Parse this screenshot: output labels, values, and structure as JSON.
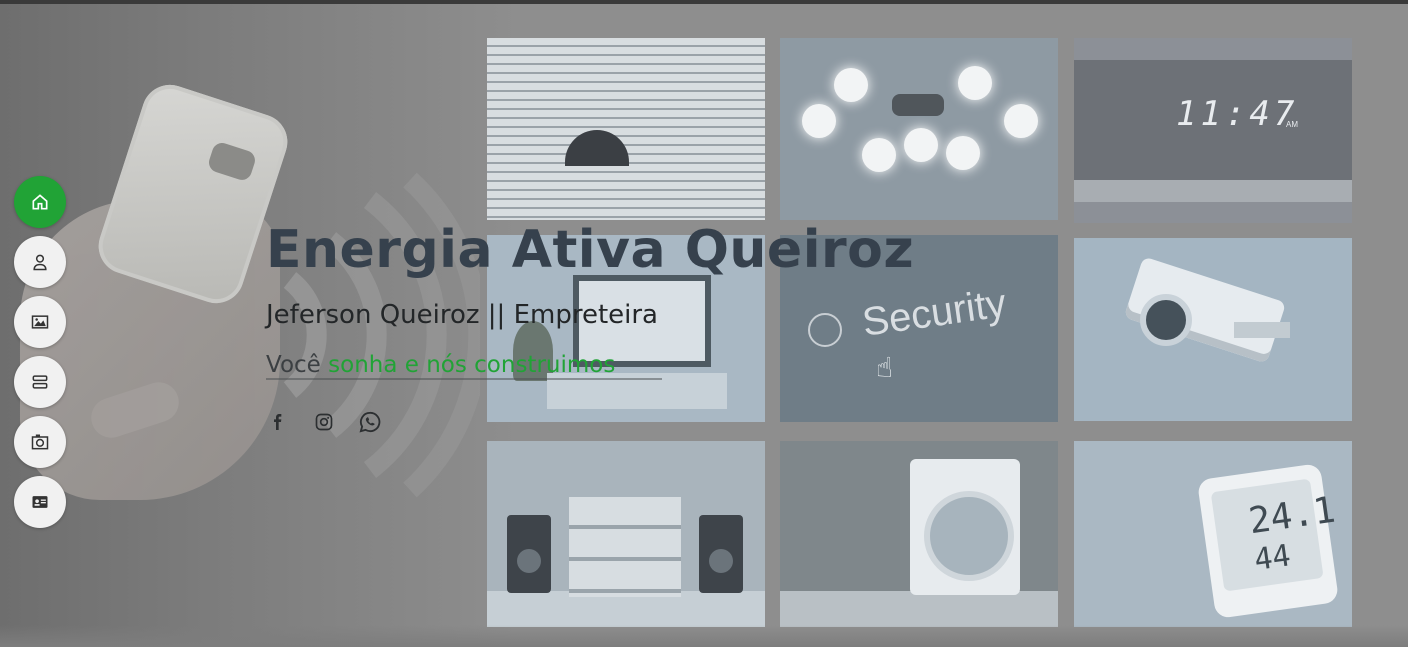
{
  "page": {
    "background_color": "#8e8e8e",
    "accent_color": "#21a336"
  },
  "hero": {
    "title": "Energia Ativa Queiroz",
    "subtitle": "Jeferson Queiroz || Empreteira",
    "tagline_prefix": "Você",
    "tagline_highlight": "sonha e nós construimos"
  },
  "tiles": [
    {
      "name": "window-blinds",
      "text": ""
    },
    {
      "name": "smart-lighting",
      "text": ""
    },
    {
      "name": "smart-clock",
      "text": "11:47",
      "suffix": "AM"
    },
    {
      "name": "smart-tv",
      "text": ""
    },
    {
      "name": "security-panel",
      "text": "Security"
    },
    {
      "name": "security-camera",
      "text": ""
    },
    {
      "name": "sound-system",
      "text": ""
    },
    {
      "name": "washing-machine",
      "text": ""
    },
    {
      "name": "thermometer-display",
      "text": "24.1",
      "text2": "44"
    }
  ],
  "social": {
    "facebook": "facebook-icon",
    "instagram": "instagram-icon",
    "whatsapp": "whatsapp-icon"
  },
  "nav": {
    "items": [
      {
        "name": "home",
        "icon": "home-icon",
        "active": true
      },
      {
        "name": "about",
        "icon": "person-icon",
        "active": false
      },
      {
        "name": "portfolio",
        "icon": "image-icon",
        "active": false
      },
      {
        "name": "services",
        "icon": "server-icon",
        "active": false
      },
      {
        "name": "gallery",
        "icon": "camera-icon",
        "active": false
      },
      {
        "name": "contact",
        "icon": "contact-card-icon",
        "active": false
      }
    ]
  }
}
